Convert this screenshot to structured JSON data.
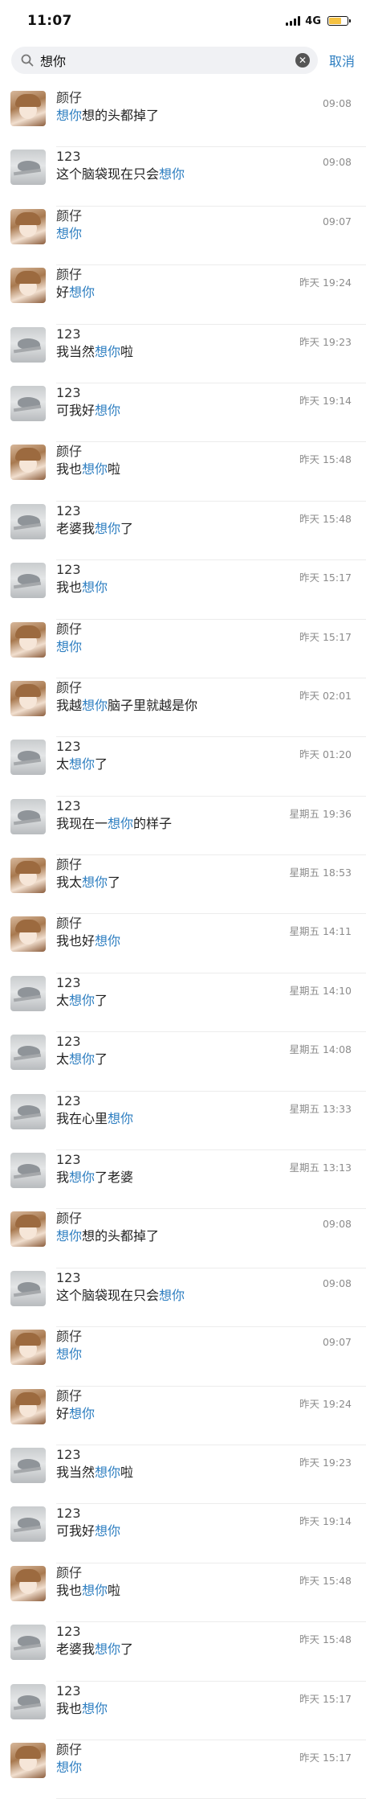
{
  "colors": {
    "accent": "#2f7fc1",
    "battery_fill": "#f5c242"
  },
  "status_bar": {
    "time": "11:07",
    "network": "4G",
    "battery_level": 0.75
  },
  "search": {
    "query": "想你",
    "cancel_label": "取消"
  },
  "results": [
    {
      "name": "颜仔",
      "avatar": "girl",
      "pre": "",
      "hl": "想你",
      "post": "想的头都掉了",
      "time": "09:08"
    },
    {
      "name": "123",
      "avatar": "bird",
      "pre": "这个脑袋现在只会",
      "hl": "想你",
      "post": "",
      "time": "09:08"
    },
    {
      "name": "颜仔",
      "avatar": "girl",
      "pre": "",
      "hl": "想你",
      "post": "",
      "time": "09:07"
    },
    {
      "name": "颜仔",
      "avatar": "girl",
      "pre": "好",
      "hl": "想你",
      "post": "",
      "time": "昨天 19:24"
    },
    {
      "name": "123",
      "avatar": "bird",
      "pre": "我当然",
      "hl": "想你",
      "post": "啦",
      "time": "昨天 19:23"
    },
    {
      "name": "123",
      "avatar": "bird",
      "pre": "可我好",
      "hl": "想你",
      "post": "",
      "time": "昨天 19:14"
    },
    {
      "name": "颜仔",
      "avatar": "girl",
      "pre": "我也",
      "hl": "想你",
      "post": "啦",
      "time": "昨天 15:48"
    },
    {
      "name": "123",
      "avatar": "bird",
      "pre": "老婆我",
      "hl": "想你",
      "post": "了",
      "time": "昨天 15:48"
    },
    {
      "name": "123",
      "avatar": "bird",
      "pre": "我也",
      "hl": "想你",
      "post": "",
      "time": "昨天 15:17"
    },
    {
      "name": "颜仔",
      "avatar": "girl",
      "pre": "",
      "hl": "想你",
      "post": "",
      "time": "昨天 15:17"
    },
    {
      "name": "颜仔",
      "avatar": "girl",
      "pre": "我越",
      "hl": "想你",
      "post": "脑子里就越是你",
      "time": "昨天 02:01"
    },
    {
      "name": "123",
      "avatar": "bird",
      "pre": "太",
      "hl": "想你",
      "post": "了",
      "time": "昨天 01:20"
    },
    {
      "name": "123",
      "avatar": "bird",
      "pre": "我现在一",
      "hl": "想你",
      "post": "的样子",
      "time": "星期五 19:36"
    },
    {
      "name": "颜仔",
      "avatar": "girl",
      "pre": "我太",
      "hl": "想你",
      "post": "了",
      "time": "星期五 18:53"
    },
    {
      "name": "颜仔",
      "avatar": "girl",
      "pre": "我也好",
      "hl": "想你",
      "post": "",
      "time": "星期五 14:11"
    },
    {
      "name": "123",
      "avatar": "bird",
      "pre": "太",
      "hl": "想你",
      "post": "了",
      "time": "星期五 14:10"
    },
    {
      "name": "123",
      "avatar": "bird",
      "pre": "太",
      "hl": "想你",
      "post": "了",
      "time": "星期五 14:08"
    },
    {
      "name": "123",
      "avatar": "bird",
      "pre": "我在心里",
      "hl": "想你",
      "post": "",
      "time": "星期五 13:33"
    },
    {
      "name": "123",
      "avatar": "bird",
      "pre": "我",
      "hl": "想你",
      "post": "了老婆",
      "time": "星期五 13:13"
    },
    {
      "name": "颜仔",
      "avatar": "girl",
      "pre": "",
      "hl": "想你",
      "post": "想的头都掉了",
      "time": "09:08"
    },
    {
      "name": "123",
      "avatar": "bird",
      "pre": "这个脑袋现在只会",
      "hl": "想你",
      "post": "",
      "time": "09:08"
    },
    {
      "name": "颜仔",
      "avatar": "girl",
      "pre": "",
      "hl": "想你",
      "post": "",
      "time": "09:07"
    },
    {
      "name": "颜仔",
      "avatar": "girl",
      "pre": "好",
      "hl": "想你",
      "post": "",
      "time": "昨天 19:24"
    },
    {
      "name": "123",
      "avatar": "bird",
      "pre": "我当然",
      "hl": "想你",
      "post": "啦",
      "time": "昨天 19:23"
    },
    {
      "name": "123",
      "avatar": "bird",
      "pre": "可我好",
      "hl": "想你",
      "post": "",
      "time": "昨天 19:14"
    },
    {
      "name": "颜仔",
      "avatar": "girl",
      "pre": "我也",
      "hl": "想你",
      "post": "啦",
      "time": "昨天 15:48"
    },
    {
      "name": "123",
      "avatar": "bird",
      "pre": "老婆我",
      "hl": "想你",
      "post": "了",
      "time": "昨天 15:48"
    },
    {
      "name": "123",
      "avatar": "bird",
      "pre": "我也",
      "hl": "想你",
      "post": "",
      "time": "昨天 15:17"
    },
    {
      "name": "颜仔",
      "avatar": "girl",
      "pre": "",
      "hl": "想你",
      "post": "",
      "time": "昨天 15:17"
    }
  ]
}
